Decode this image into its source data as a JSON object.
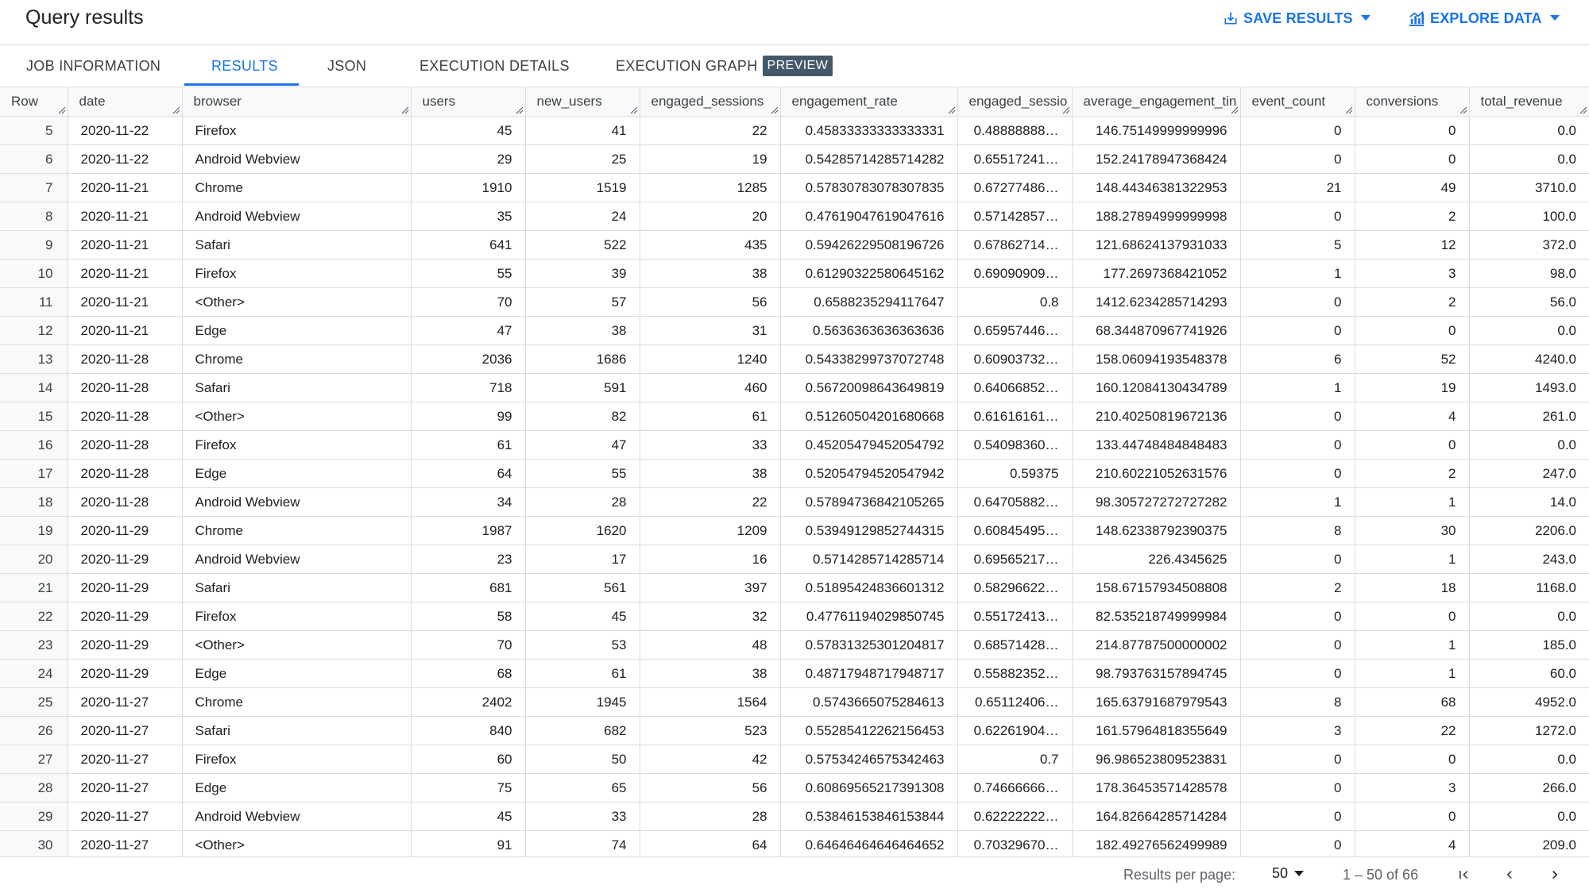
{
  "header": {
    "title": "Query results",
    "save_label": "SAVE RESULTS",
    "explore_label": "EXPLORE DATA"
  },
  "tabs": [
    {
      "label": "JOB INFORMATION",
      "active": false
    },
    {
      "label": "RESULTS",
      "active": true
    },
    {
      "label": "JSON",
      "active": false
    },
    {
      "label": "EXECUTION DETAILS",
      "active": false
    },
    {
      "label": "EXECUTION GRAPH",
      "active": false,
      "badge": "PREVIEW"
    }
  ],
  "colors": {
    "accent": "#1a73e8",
    "badge": "#45586a",
    "border": "#dadce0",
    "header_bg": "#f8f9fa"
  },
  "table": {
    "columns": [
      "Row",
      "date",
      "browser",
      "users",
      "new_users",
      "engaged_sessions",
      "engagement_rate",
      "engaged_sessio",
      "average_engagement_tin",
      "event_count",
      "conversions",
      "total_revenue"
    ],
    "rows": [
      [
        "5",
        "2020-11-22",
        "Firefox",
        "45",
        "41",
        "22",
        "0.45833333333333331",
        "0.48888888…",
        "146.75149999999996",
        "0",
        "0",
        "0.0"
      ],
      [
        "6",
        "2020-11-22",
        "Android Webview",
        "29",
        "25",
        "19",
        "0.54285714285714282",
        "0.65517241…",
        "152.24178947368424",
        "0",
        "0",
        "0.0"
      ],
      [
        "7",
        "2020-11-21",
        "Chrome",
        "1910",
        "1519",
        "1285",
        "0.57830783078307835",
        "0.67277486…",
        "148.44346381322953",
        "21",
        "49",
        "3710.0"
      ],
      [
        "8",
        "2020-11-21",
        "Android Webview",
        "35",
        "24",
        "20",
        "0.47619047619047616",
        "0.57142857…",
        "188.27894999999998",
        "0",
        "2",
        "100.0"
      ],
      [
        "9",
        "2020-11-21",
        "Safari",
        "641",
        "522",
        "435",
        "0.59426229508196726",
        "0.67862714…",
        "121.68624137931033",
        "5",
        "12",
        "372.0"
      ],
      [
        "10",
        "2020-11-21",
        "Firefox",
        "55",
        "39",
        "38",
        "0.61290322580645162",
        "0.69090909…",
        "177.2697368421052",
        "1",
        "3",
        "98.0"
      ],
      [
        "11",
        "2020-11-21",
        "<Other>",
        "70",
        "57",
        "56",
        "0.6588235294117647",
        "0.8",
        "1412.6234285714293",
        "0",
        "2",
        "56.0"
      ],
      [
        "12",
        "2020-11-21",
        "Edge",
        "47",
        "38",
        "31",
        "0.5636363636363636",
        "0.65957446…",
        "68.344870967741926",
        "0",
        "0",
        "0.0"
      ],
      [
        "13",
        "2020-11-28",
        "Chrome",
        "2036",
        "1686",
        "1240",
        "0.54338299737072748",
        "0.60903732…",
        "158.06094193548378",
        "6",
        "52",
        "4240.0"
      ],
      [
        "14",
        "2020-11-28",
        "Safari",
        "718",
        "591",
        "460",
        "0.56720098643649819",
        "0.64066852…",
        "160.12084130434789",
        "1",
        "19",
        "1493.0"
      ],
      [
        "15",
        "2020-11-28",
        "<Other>",
        "99",
        "82",
        "61",
        "0.51260504201680668",
        "0.61616161…",
        "210.40250819672136",
        "0",
        "4",
        "261.0"
      ],
      [
        "16",
        "2020-11-28",
        "Firefox",
        "61",
        "47",
        "33",
        "0.45205479452054792",
        "0.54098360…",
        "133.44748484848483",
        "0",
        "0",
        "0.0"
      ],
      [
        "17",
        "2020-11-28",
        "Edge",
        "64",
        "55",
        "38",
        "0.52054794520547942",
        "0.59375",
        "210.60221052631576",
        "0",
        "2",
        "247.0"
      ],
      [
        "18",
        "2020-11-28",
        "Android Webview",
        "34",
        "28",
        "22",
        "0.57894736842105265",
        "0.64705882…",
        "98.305727272727282",
        "1",
        "1",
        "14.0"
      ],
      [
        "19",
        "2020-11-29",
        "Chrome",
        "1987",
        "1620",
        "1209",
        "0.53949129852744315",
        "0.60845495…",
        "148.62338792390375",
        "8",
        "30",
        "2206.0"
      ],
      [
        "20",
        "2020-11-29",
        "Android Webview",
        "23",
        "17",
        "16",
        "0.5714285714285714",
        "0.69565217…",
        "226.4345625",
        "0",
        "1",
        "243.0"
      ],
      [
        "21",
        "2020-11-29",
        "Safari",
        "681",
        "561",
        "397",
        "0.51895424836601312",
        "0.58296622…",
        "158.67157934508808",
        "2",
        "18",
        "1168.0"
      ],
      [
        "22",
        "2020-11-29",
        "Firefox",
        "58",
        "45",
        "32",
        "0.47761194029850745",
        "0.55172413…",
        "82.535218749999984",
        "0",
        "0",
        "0.0"
      ],
      [
        "23",
        "2020-11-29",
        "<Other>",
        "70",
        "53",
        "48",
        "0.57831325301204817",
        "0.68571428…",
        "214.87787500000002",
        "0",
        "1",
        "185.0"
      ],
      [
        "24",
        "2020-11-29",
        "Edge",
        "68",
        "61",
        "38",
        "0.48717948717948717",
        "0.55882352…",
        "98.793763157894745",
        "0",
        "1",
        "60.0"
      ],
      [
        "25",
        "2020-11-27",
        "Chrome",
        "2402",
        "1945",
        "1564",
        "0.5743665075284613",
        "0.65112406…",
        "165.63791687979543",
        "8",
        "68",
        "4952.0"
      ],
      [
        "26",
        "2020-11-27",
        "Safari",
        "840",
        "682",
        "523",
        "0.55285412262156453",
        "0.62261904…",
        "161.57964818355649",
        "3",
        "22",
        "1272.0"
      ],
      [
        "27",
        "2020-11-27",
        "Firefox",
        "60",
        "50",
        "42",
        "0.57534246575342463",
        "0.7",
        "96.986523809523831",
        "0",
        "0",
        "0.0"
      ],
      [
        "28",
        "2020-11-27",
        "Edge",
        "75",
        "65",
        "56",
        "0.60869565217391308",
        "0.74666666…",
        "178.36453571428578",
        "0",
        "3",
        "266.0"
      ],
      [
        "29",
        "2020-11-27",
        "Android Webview",
        "45",
        "33",
        "28",
        "0.53846153846153844",
        "0.62222222…",
        "164.82664285714284",
        "0",
        "0",
        "0.0"
      ],
      [
        "30",
        "2020-11-27",
        "<Other>",
        "91",
        "74",
        "64",
        "0.64646464646464652",
        "0.70329670…",
        "182.49276562499989",
        "0",
        "4",
        "209.0"
      ]
    ]
  },
  "footer": {
    "per_page_label": "Results per page:",
    "per_page_value": "50",
    "range": "1 – 50 of 66"
  }
}
